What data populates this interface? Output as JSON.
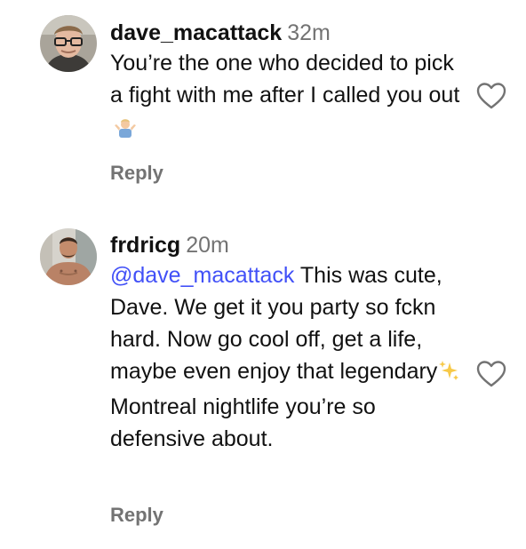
{
  "comments": [
    {
      "username": "dave_macattack",
      "time": "32m",
      "text": "You’re the one who decided to pick a fight with me after I called you out",
      "emoji": "person-shrugging-emoji",
      "reply_label": "Reply"
    },
    {
      "username": "frdricg",
      "time": "20m",
      "mention": "@dave_macattack",
      "text_before_emoji": " This was cute, Dave. We get it you party so fckn hard. Now go cool off, get a life, maybe even enjoy that legendary",
      "emoji": "sparkles-emoji",
      "text_after_emoji": " Montreal nightlife you’re so defensive about.",
      "reply_label": "Reply"
    }
  ],
  "colors": {
    "mention": "#4150f7",
    "secondary_text": "#737373",
    "primary_text": "#111111"
  },
  "icons": [
    "heart-outline-icon"
  ]
}
